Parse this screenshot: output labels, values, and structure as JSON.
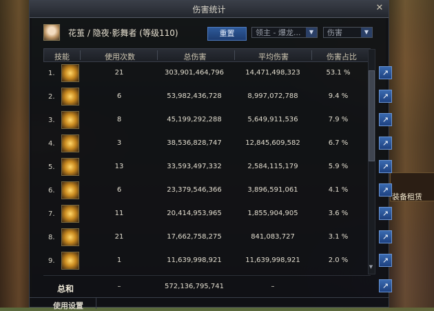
{
  "window": {
    "title": "伤害统计",
    "close_icon": "close-icon"
  },
  "header": {
    "character": "花茧 / 隐夜·影舞者 (等级110)",
    "reset_label": "重置",
    "boss_select": {
      "value": "领主 - 爆龙..."
    },
    "type_select": {
      "value": "伤害"
    }
  },
  "columns": {
    "skill": "技能",
    "count": "使用次数",
    "total": "总伤害",
    "avg": "平均伤害",
    "pct": "伤害占比"
  },
  "rows": [
    {
      "idx": "1.",
      "count": "21",
      "total": "303,901,464,796",
      "avg": "14,471,498,323",
      "pct": "53.1 %"
    },
    {
      "idx": "2.",
      "count": "6",
      "total": "53,982,436,728",
      "avg": "8,997,072,788",
      "pct": "9.4 %"
    },
    {
      "idx": "3.",
      "count": "8",
      "total": "45,199,292,288",
      "avg": "5,649,911,536",
      "pct": "7.9 %"
    },
    {
      "idx": "4.",
      "count": "3",
      "total": "38,536,828,747",
      "avg": "12,845,609,582",
      "pct": "6.7 %"
    },
    {
      "idx": "5.",
      "count": "13",
      "total": "33,593,497,332",
      "avg": "2,584,115,179",
      "pct": "5.9 %"
    },
    {
      "idx": "6.",
      "count": "6",
      "total": "23,379,546,366",
      "avg": "3,896,591,061",
      "pct": "4.1 %"
    },
    {
      "idx": "7.",
      "count": "11",
      "total": "20,414,953,965",
      "avg": "1,855,904,905",
      "pct": "3.6 %"
    },
    {
      "idx": "8.",
      "count": "21",
      "total": "17,662,758,275",
      "avg": "841,083,727",
      "pct": "3.1 %"
    },
    {
      "idx": "9.",
      "count": "1",
      "total": "11,639,998,921",
      "avg": "11,639,998,921",
      "pct": "2.0 %"
    }
  ],
  "total": {
    "label": "总和",
    "count": "–",
    "total": "572,136,795,741",
    "avg": "–"
  },
  "bottom": {
    "label": "使用设置"
  },
  "background": {
    "shop_text": "装备租赁"
  }
}
